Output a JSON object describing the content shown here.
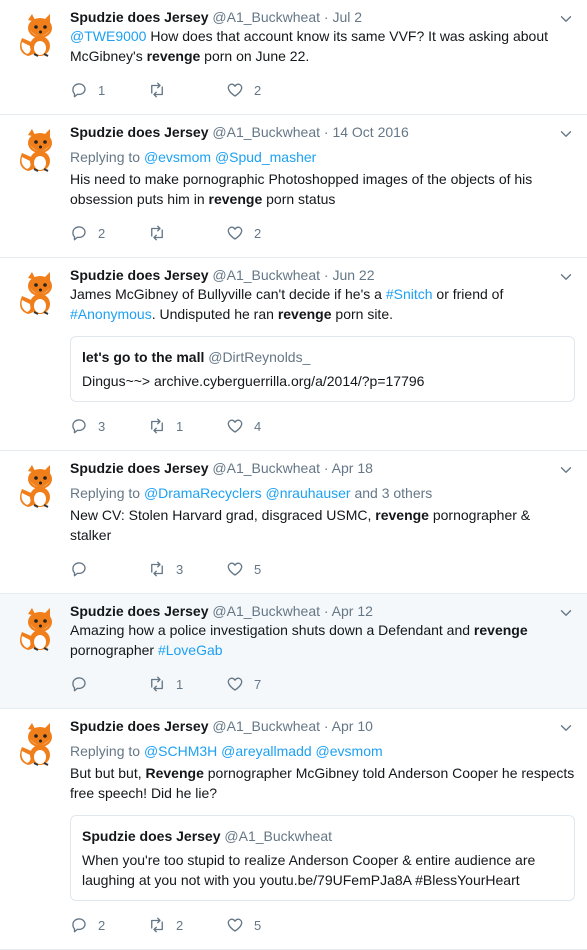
{
  "tweets": [
    {
      "name": "Spudzie does Jersey",
      "handle": "@A1_Buckwheat",
      "date": " · Jul 2",
      "reply_to": null,
      "text": [
        {
          "t": "@TWE9000",
          "k": "m"
        },
        {
          "t": " How does that account know its same VVF? It was asking about McGibney's "
        },
        {
          "t": "revenge",
          "k": "b"
        },
        {
          "t": " porn on June 22."
        }
      ],
      "quote": null,
      "reply_count": "1",
      "retweet_count": "",
      "like_count": "2"
    },
    {
      "name": "Spudzie does Jersey",
      "handle": "@A1_Buckwheat",
      "date": " · 14 Oct 2016",
      "reply_to": [
        {
          "t": "Replying to "
        },
        {
          "t": "@evsmom",
          "k": "m"
        },
        {
          "t": " "
        },
        {
          "t": "@Spud_masher",
          "k": "m"
        }
      ],
      "text": [
        {
          "t": "His need to make pornographic Photoshopped images of the objects of his obsession puts him in "
        },
        {
          "t": "revenge",
          "k": "b"
        },
        {
          "t": " porn status"
        }
      ],
      "quote": null,
      "reply_count": "2",
      "retweet_count": "",
      "like_count": "2"
    },
    {
      "name": "Spudzie does Jersey",
      "handle": "@A1_Buckwheat",
      "date": " · Jun 22",
      "reply_to": null,
      "text": [
        {
          "t": "James McGibney of Bullyville can't decide if he's a "
        },
        {
          "t": "#Snitch",
          "k": "m"
        },
        {
          "t": " or friend of "
        },
        {
          "t": "#Anonymous",
          "k": "m"
        },
        {
          "t": ". Undisputed he ran "
        },
        {
          "t": "revenge",
          "k": "b"
        },
        {
          "t": " porn site."
        }
      ],
      "quote": {
        "name": "let's go to the mall",
        "handle": "@DirtReynolds_",
        "text": "Dingus~~> archive.cyberguerrilla.org/a/2014/?p=17796"
      },
      "reply_count": "3",
      "retweet_count": "1",
      "like_count": "4"
    },
    {
      "name": "Spudzie does Jersey",
      "handle": "@A1_Buckwheat",
      "date": " · Apr 18",
      "reply_to": [
        {
          "t": "Replying to "
        },
        {
          "t": "@DramaRecyclers",
          "k": "m"
        },
        {
          "t": " "
        },
        {
          "t": "@nrauhauser",
          "k": "m"
        },
        {
          "t": " and 3 others"
        }
      ],
      "text": [
        {
          "t": "New CV: Stolen Harvard grad, disgraced USMC, "
        },
        {
          "t": "revenge",
          "k": "b"
        },
        {
          "t": " pornographer & stalker"
        }
      ],
      "quote": null,
      "reply_count": "",
      "retweet_count": "3",
      "like_count": "5"
    },
    {
      "name": "Spudzie does Jersey",
      "handle": "@A1_Buckwheat",
      "date": " · Apr 12",
      "reply_to": null,
      "highlight": true,
      "text": [
        {
          "t": "Amazing how a police investigation shuts down a Defendant and "
        },
        {
          "t": "revenge",
          "k": "b"
        },
        {
          "t": " pornographer "
        },
        {
          "t": "#LoveGab",
          "k": "m"
        }
      ],
      "quote": null,
      "reply_count": "",
      "retweet_count": "1",
      "like_count": "7"
    },
    {
      "name": "Spudzie does Jersey",
      "handle": "@A1_Buckwheat",
      "date": " · Apr 10",
      "reply_to": [
        {
          "t": "Replying to "
        },
        {
          "t": "@SCHM3H",
          "k": "m"
        },
        {
          "t": " "
        },
        {
          "t": "@areyallmadd",
          "k": "m"
        },
        {
          "t": " "
        },
        {
          "t": "@evsmom",
          "k": "m"
        }
      ],
      "text": [
        {
          "t": "But but but, "
        },
        {
          "t": "Revenge",
          "k": "b"
        },
        {
          "t": " pornographer McGibney told Anderson Cooper he respects free speech! Did he lie?"
        }
      ],
      "quote": {
        "name": "Spudzie does Jersey",
        "handle": "@A1_Buckwheat",
        "text": "When you're too stupid to realize Anderson Cooper & entire audience are laughing at you not with you youtu.be/79UFemPJa8A #BlessYourHeart"
      },
      "reply_count": "2",
      "retweet_count": "2",
      "like_count": "5"
    }
  ],
  "icons": {
    "reply": "reply-icon",
    "retweet": "retweet-icon",
    "like": "like-icon",
    "caret": "chevron-down-icon",
    "avatar": "fox-avatar"
  },
  "colors": {
    "link": "#1da1f2",
    "muted": "#657786",
    "border": "#e6ecf0",
    "highlight_bg": "#f5f8fa"
  }
}
